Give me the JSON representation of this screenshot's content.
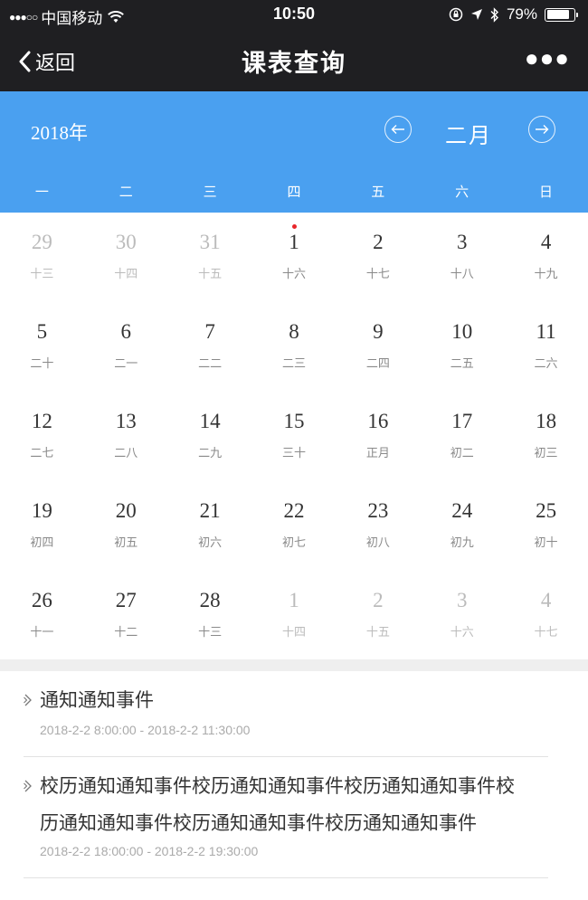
{
  "status_bar": {
    "carrier": "中国移动",
    "time": "10:50",
    "battery": "79%",
    "battery_level": 0.79
  },
  "nav": {
    "back_label": "返回",
    "title": "课表查询"
  },
  "calendar": {
    "year_label": "2018年",
    "month_label": "二月",
    "weekdays": [
      "一",
      "二",
      "三",
      "四",
      "五",
      "六",
      "日"
    ],
    "weeks": [
      [
        {
          "d": "29",
          "l": "十三",
          "other": true
        },
        {
          "d": "30",
          "l": "十四",
          "other": true
        },
        {
          "d": "31",
          "l": "十五",
          "other": true
        },
        {
          "d": "1",
          "l": "十六",
          "mark": true
        },
        {
          "d": "2",
          "l": "十七"
        },
        {
          "d": "3",
          "l": "十八"
        },
        {
          "d": "4",
          "l": "十九"
        }
      ],
      [
        {
          "d": "5",
          "l": "二十"
        },
        {
          "d": "6",
          "l": "二一"
        },
        {
          "d": "7",
          "l": "二二"
        },
        {
          "d": "8",
          "l": "二三"
        },
        {
          "d": "9",
          "l": "二四"
        },
        {
          "d": "10",
          "l": "二五"
        },
        {
          "d": "11",
          "l": "二六"
        }
      ],
      [
        {
          "d": "12",
          "l": "二七"
        },
        {
          "d": "13",
          "l": "二八"
        },
        {
          "d": "14",
          "l": "二九"
        },
        {
          "d": "15",
          "l": "三十"
        },
        {
          "d": "16",
          "l": "正月"
        },
        {
          "d": "17",
          "l": "初二"
        },
        {
          "d": "18",
          "l": "初三"
        }
      ],
      [
        {
          "d": "19",
          "l": "初四"
        },
        {
          "d": "20",
          "l": "初五"
        },
        {
          "d": "21",
          "l": "初六"
        },
        {
          "d": "22",
          "l": "初七"
        },
        {
          "d": "23",
          "l": "初八"
        },
        {
          "d": "24",
          "l": "初九"
        },
        {
          "d": "25",
          "l": "初十"
        }
      ],
      [
        {
          "d": "26",
          "l": "十一"
        },
        {
          "d": "27",
          "l": "十二"
        },
        {
          "d": "28",
          "l": "十三"
        },
        {
          "d": "1",
          "l": "十四",
          "other": true
        },
        {
          "d": "2",
          "l": "十五",
          "other": true
        },
        {
          "d": "3",
          "l": "十六",
          "other": true
        },
        {
          "d": "4",
          "l": "十七",
          "other": true
        }
      ]
    ]
  },
  "events": [
    {
      "title_lines": [
        "通知通知事件"
      ],
      "time": "2018-2-2 8:00:00 - 2018-2-2 11:30:00"
    },
    {
      "title_lines": [
        "校历通知通知事件校历通知通知事件校历通知通知事件校",
        "历通知通知事件校历通知通知事件校历通知通知事件"
      ],
      "time": "2018-2-2 18:00:00 - 2018-2-2 19:30:00"
    }
  ],
  "colors": {
    "header_blue": "#4aa0f0",
    "top_bar": "#1f1f22",
    "marker_red": "#e8262a"
  },
  "icons": {
    "back": "chevron-left-icon",
    "more": "more-dots-icon",
    "prev": "arrow-left-circle-icon",
    "next": "arrow-right-circle-icon",
    "event": "chevron-right-icon"
  }
}
